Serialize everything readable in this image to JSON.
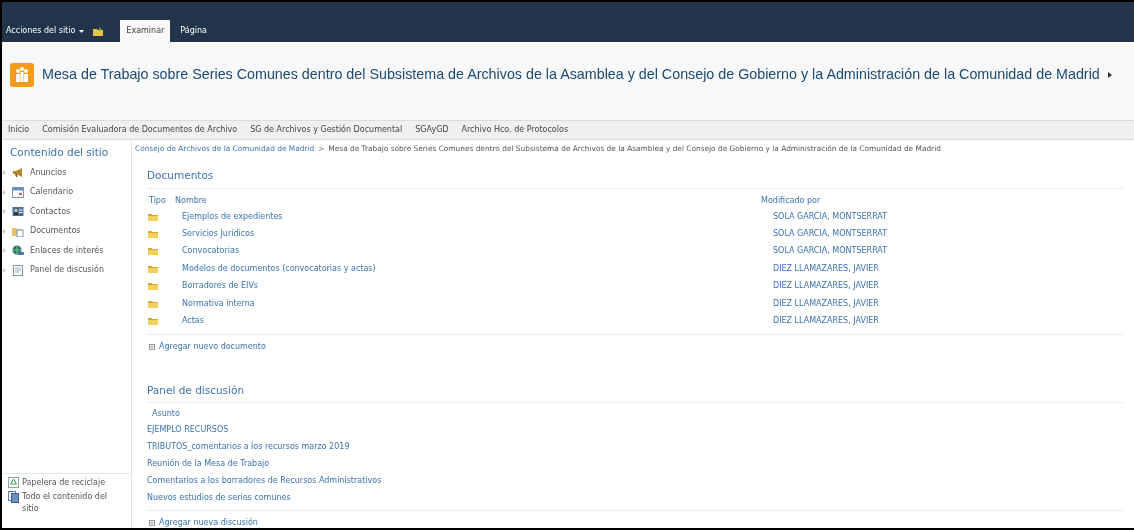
{
  "ribbon": {
    "site_actions": "Acciones del sitio",
    "tabs": [
      {
        "label": "Examinar",
        "selected": true
      },
      {
        "label": "Página",
        "selected": false
      }
    ]
  },
  "site_title": "Mesa de Trabajo sobre Series Comunes dentro del Subsistema de Archivos de la Asamblea y del Consejo de Gobierno y la Administración de la Comunidad de Madrid",
  "top_nav": [
    "Inicio",
    "Comisión Evaluadora de Documentos de Archivo",
    "SG de Archivos y Gestión Documental",
    "SGAyGD",
    "Archivo Hco. de Protocolos"
  ],
  "breadcrumb": {
    "link": "Consejo de Archivos de la Comunidad de Madrid",
    "separator": ">",
    "current": "Mesa de Trabajo sobre Series Comunes dentro del Subsistema de Archivos de la Asamblea y del Consejo de Gobierno y la Administración de la Comunidad de Madrid"
  },
  "quick_launch": {
    "heading": "Contenido del sitio",
    "items": [
      {
        "label": "Anuncios",
        "kind": "announcements"
      },
      {
        "label": "Calendario",
        "kind": "calendar"
      },
      {
        "label": "Contactos",
        "kind": "contacts"
      },
      {
        "label": "Documentos",
        "kind": "documents"
      },
      {
        "label": "Enlaces de interés",
        "kind": "links"
      },
      {
        "label": "Panel de discusión",
        "kind": "discussion"
      }
    ],
    "bottom": [
      {
        "label": "Papelera de reciclaje",
        "kind": "recycle"
      },
      {
        "label": "Todo el contenido del sitio",
        "kind": "all"
      }
    ]
  },
  "documents": {
    "title": "Documentos",
    "columns": [
      "Tipo",
      "Nombre",
      "Modificado por"
    ],
    "rows": [
      {
        "name": "Ejemplos de expedientes",
        "modified_by": "SOLA GARCIA, MONTSERRAT"
      },
      {
        "name": "Servicios Jurídicos",
        "modified_by": "SOLA GARCIA, MONTSERRAT"
      },
      {
        "name": "Convocatorias",
        "modified_by": "SOLA GARCIA, MONTSERRAT"
      },
      {
        "name": "Modelos de documentos (convocatorias y actas)",
        "modified_by": "DIEZ LLAMAZARES, JAVIER"
      },
      {
        "name": "Borradores de EIVs",
        "modified_by": "DIEZ LLAMAZARES, JAVIER"
      },
      {
        "name": "Normativa interna",
        "modified_by": "DIEZ LLAMAZARES, JAVIER"
      },
      {
        "name": "Actas",
        "modified_by": "DIEZ LLAMAZARES, JAVIER"
      }
    ],
    "add_link": "Agregar nuevo documento"
  },
  "discussion": {
    "title": "Panel de discusión",
    "column": "Asunto",
    "rows": [
      "EJEMPLO RECURSOS",
      "TRIBUTOS_comentarios a los recursos marzo 2019",
      "Reunión de la Mesa de Trabajo",
      "Comentarios a los borradores de Recursos Administrativos",
      "Nuevos estudios de series comunes"
    ],
    "add_link": "Agregar nueva discusión"
  }
}
